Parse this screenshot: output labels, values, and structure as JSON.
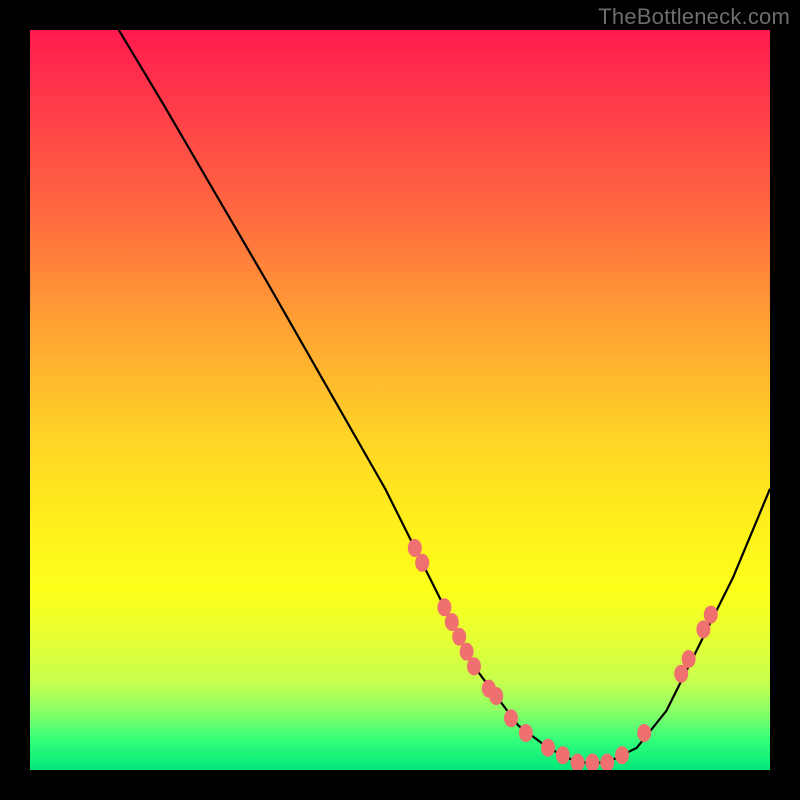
{
  "attribution": "TheBottleneck.com",
  "colors": {
    "background": "#000000",
    "gradient_top": "#ff1a4d",
    "gradient_bottom": "#00e87a",
    "curve": "#000000",
    "marker": "#f07070"
  },
  "chart_data": {
    "type": "line",
    "title": "",
    "xlabel": "",
    "ylabel": "",
    "xlim": [
      0,
      100
    ],
    "ylim": [
      0,
      100
    ],
    "grid": false,
    "legend": false,
    "series": [
      {
        "name": "bottleneck-curve",
        "x": [
          12,
          18,
          25,
          32,
          40,
          48,
          52,
          55,
          58,
          60,
          63,
          66,
          70,
          74,
          78,
          82,
          86,
          90,
          95,
          100
        ],
        "y": [
          100,
          90,
          78,
          66,
          52,
          38,
          30,
          24,
          18,
          14,
          10,
          6,
          3,
          1,
          1,
          3,
          8,
          16,
          26,
          38
        ]
      }
    ],
    "markers": [
      {
        "x": 52,
        "y": 30
      },
      {
        "x": 53,
        "y": 28
      },
      {
        "x": 56,
        "y": 22
      },
      {
        "x": 57,
        "y": 20
      },
      {
        "x": 58,
        "y": 18
      },
      {
        "x": 59,
        "y": 16
      },
      {
        "x": 60,
        "y": 14
      },
      {
        "x": 62,
        "y": 11
      },
      {
        "x": 63,
        "y": 10
      },
      {
        "x": 65,
        "y": 7
      },
      {
        "x": 67,
        "y": 5
      },
      {
        "x": 70,
        "y": 3
      },
      {
        "x": 72,
        "y": 2
      },
      {
        "x": 74,
        "y": 1
      },
      {
        "x": 76,
        "y": 1
      },
      {
        "x": 78,
        "y": 1
      },
      {
        "x": 80,
        "y": 2
      },
      {
        "x": 83,
        "y": 5
      },
      {
        "x": 88,
        "y": 13
      },
      {
        "x": 89,
        "y": 15
      },
      {
        "x": 91,
        "y": 19
      },
      {
        "x": 92,
        "y": 21
      }
    ]
  }
}
